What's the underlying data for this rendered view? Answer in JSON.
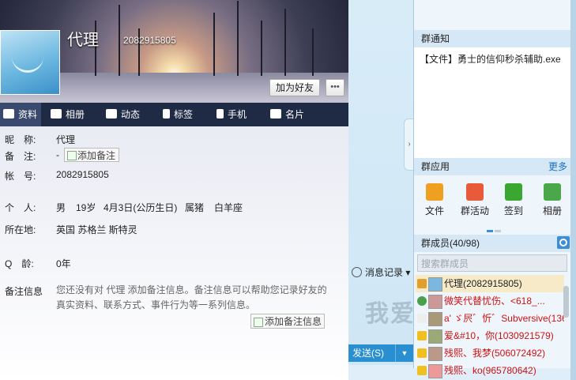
{
  "profile": {
    "nickname": "代理",
    "qq_number": "2082915805",
    "add_friend_label": "加为好友",
    "tabs": [
      {
        "label": "资料"
      },
      {
        "label": "相册"
      },
      {
        "label": "动态"
      },
      {
        "label": "标签"
      },
      {
        "label": "手机"
      },
      {
        "label": "名片"
      }
    ],
    "fields": {
      "nick_label": "昵　称:",
      "nick_value": "代理",
      "note_label": "备　注:",
      "note_value": "-",
      "add_note_label": "添加备注",
      "account_label": "帐　号:",
      "account_value": "2082915805",
      "personal_label": "个　人:",
      "gender": "男",
      "age": "19岁",
      "birthday": "4月3日(公历生日)",
      "zodiac": "属猪",
      "star_sign": "白羊座",
      "location_label": "所在地:",
      "location_value": "英国 苏格兰 斯特灵",
      "qage_label": "Q　龄:",
      "qage_value": "0年",
      "note_info_label": "备注信息",
      "note_info_desc": "您还没有对 代理 添加备注信息。备注信息可以帮助您记录好友的真实资料、联系方式、事件行为等一系列信息。",
      "add_note_info_label": "添加备注信息"
    }
  },
  "chat": {
    "history_label": "消息记录",
    "watermark": "我爱",
    "send_label": "发送(S)",
    "dropdown_arrow": "▼"
  },
  "group": {
    "notice_title": "群通知",
    "notice_text": "【文件】勇士的信仰秒杀辅助.exe",
    "apps_title": "群应用",
    "more_label": "更多",
    "apps": [
      {
        "label": "文件",
        "color": "#f0a020"
      },
      {
        "label": "群活动",
        "color": "#e85a3a"
      },
      {
        "label": "签到",
        "color": "#3aa830"
      },
      {
        "label": "相册",
        "color": "#4aa84a"
      }
    ],
    "members_title": "群成员(40/98)",
    "search_placeholder": "搜索群成员",
    "members": [
      {
        "name": "代理(2082915805)",
        "color": "#222222",
        "badge": "#e0a030",
        "selected": true
      },
      {
        "name": "微笑代替忧伤、<618_...",
        "color": "#d01010",
        "badge": "#49a04a",
        "selected": false
      },
      {
        "name": "a' ゞ屄゛忻゛Subversive(136...",
        "color": "#d01010",
        "badge": "#eeeeee",
        "selected": false
      },
      {
        "name": "爱&#10，你(1030921579)",
        "color": "#d01010",
        "badge": "#f0c020",
        "selected": false
      },
      {
        "name": "残熙、我梦(506072492)",
        "color": "#d01010",
        "badge": "#f0c020",
        "selected": false
      },
      {
        "name": "残熙、ko(965780642)",
        "color": "#d01010",
        "badge": "#f0c020",
        "selected": false
      }
    ]
  }
}
